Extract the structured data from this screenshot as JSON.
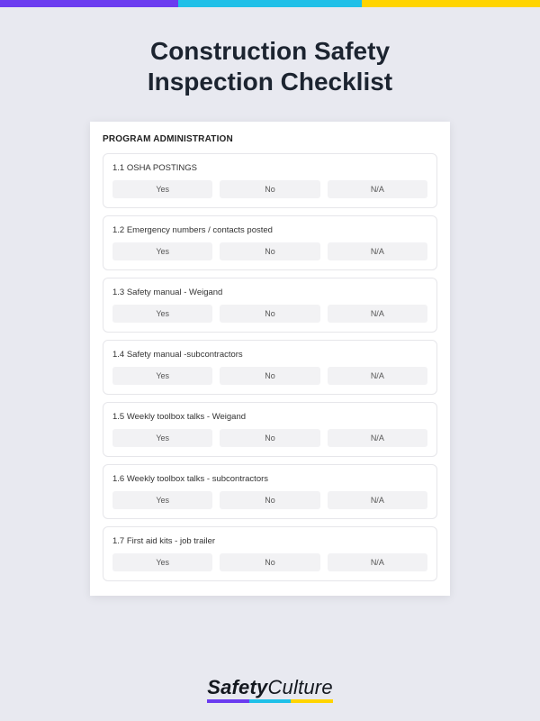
{
  "colors": {
    "purple": "#6b3cf0",
    "cyan": "#1fc0e8",
    "yellow": "#ffd400"
  },
  "title_line1": "Construction Safety",
  "title_line2": "Inspection Checklist",
  "section_header": "PROGRAM ADMINISTRATION",
  "option_labels": {
    "yes": "Yes",
    "no": "No",
    "na": "N/A"
  },
  "items": [
    {
      "q": "1.1 OSHA POSTINGS"
    },
    {
      "q": "1.2 Emergency numbers / contacts posted"
    },
    {
      "q": "1.3 Safety manual - Weigand"
    },
    {
      "q": "1.4 Safety manual -subcontractors"
    },
    {
      "q": "1.5 Weekly toolbox talks - Weigand"
    },
    {
      "q": "1.6 Weekly toolbox talks - subcontractors"
    },
    {
      "q": "1.7 First aid kits - job trailer"
    }
  ],
  "brand": {
    "bold": "Safety",
    "thin": "Culture"
  }
}
